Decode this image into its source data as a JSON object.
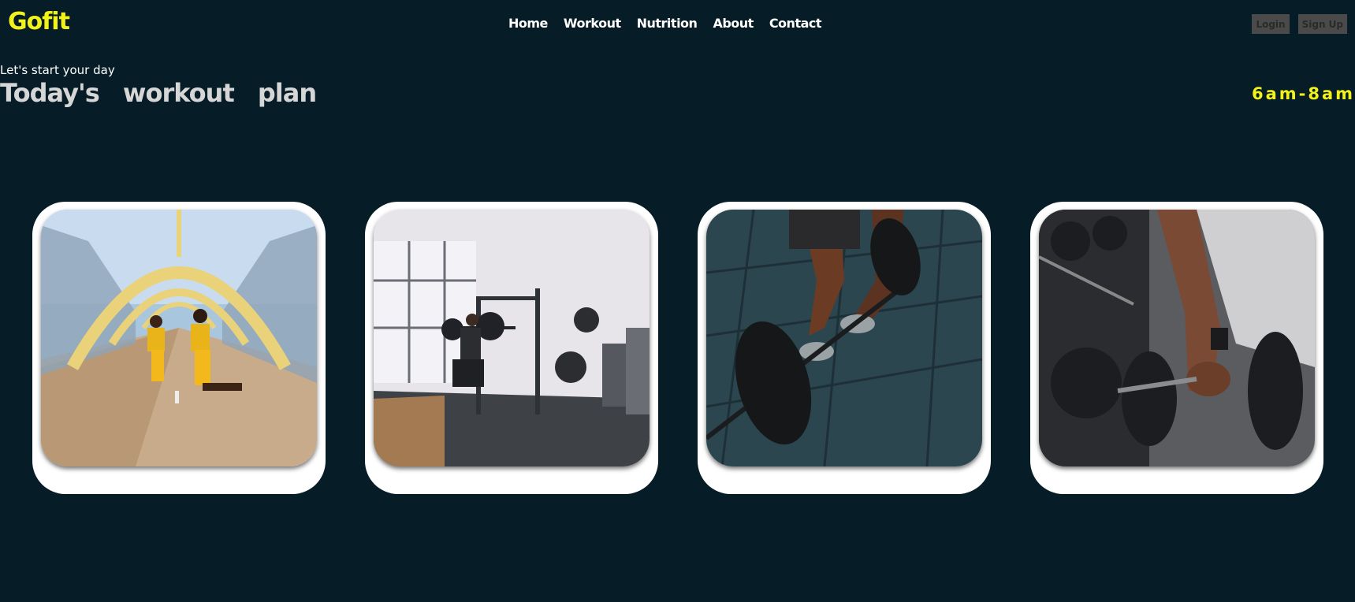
{
  "header": {
    "logo": "Gofit",
    "nav": [
      "Home",
      "Workout",
      "Nutrition",
      "About",
      "Contact"
    ],
    "login_label": "Login",
    "signup_label": "Sign Up"
  },
  "hero": {
    "subtitle": "Let's start your day",
    "title": "Today's workout plan",
    "time": "6am-8am"
  },
  "workouts": [
    {
      "photo": "bridge-lunge-photo"
    },
    {
      "photo": "gym-squat-rack-photo"
    },
    {
      "photo": "barbell-deadlift-photo"
    },
    {
      "photo": "dumbbell-rack-photo"
    }
  ],
  "colors": {
    "background": "#061d27",
    "accent": "#f2f21a",
    "card": "#ffffff"
  }
}
